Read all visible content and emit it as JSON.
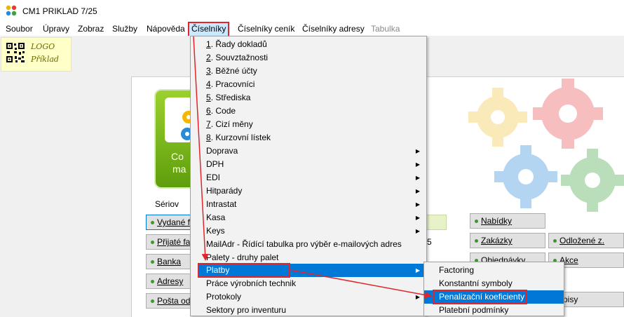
{
  "window": {
    "title": "CM1 PRIKLAD 7/25"
  },
  "menubar": {
    "items": [
      "Soubor",
      "Úpravy",
      "Zobraz",
      "Služby",
      "Nápověda",
      "Číselníky",
      "Číselníky ceník",
      "Číselníky adresy",
      "Tabulka"
    ]
  },
  "logo": {
    "line1": "LOGO",
    "line2": "Příklad"
  },
  "dashboard": {
    "tile_text1": "Co",
    "tile_text2": "ma",
    "serial_label": "Sériov",
    "number_text": "5",
    "left_buttons": [
      "Vydané f",
      "Přijaté fa",
      "Banka",
      "Adresy",
      "Pošta od"
    ],
    "right_buttons": [
      "Nabídky",
      "Zakázky",
      "Odložené z.",
      "Objednávky",
      "Akce",
      "pisy"
    ]
  },
  "dropdown": {
    "numbered": [
      {
        "num": "1",
        "rest": ". Řady dokladů"
      },
      {
        "num": "2",
        "rest": ". Souvztažnosti"
      },
      {
        "num": "3",
        "rest": ". Běžné účty"
      },
      {
        "num": "4",
        "rest": ". Pracovníci"
      },
      {
        "num": "5",
        "rest": ". Střediska"
      },
      {
        "num": "6",
        "rest": ". Code"
      },
      {
        "num": "7",
        "rest": ". Cizí měny"
      },
      {
        "num": "8",
        "rest": ". Kurzovní lístek"
      }
    ],
    "items": [
      {
        "label": "Doprava",
        "submenu": true
      },
      {
        "label": "DPH",
        "submenu": true
      },
      {
        "label": "EDI",
        "submenu": true
      },
      {
        "label": "Hitparády",
        "submenu": true
      },
      {
        "label": "Intrastat",
        "submenu": true
      },
      {
        "label": "Kasa",
        "submenu": true
      },
      {
        "label": "Keys",
        "submenu": true
      },
      {
        "label": "MailAdr - Řídící tabulka pro výběr e-mailových adres",
        "submenu": false
      },
      {
        "label": "Palety - druhy palet",
        "submenu": false
      },
      {
        "label": "Platby",
        "submenu": true,
        "selected": true
      },
      {
        "label": "Práce výrobních technik",
        "submenu": false
      },
      {
        "label": "Protokoly",
        "submenu": true
      },
      {
        "label": "Sektory pro inventuru",
        "submenu": false
      }
    ]
  },
  "submenu": {
    "items": [
      "Factoring",
      "Konstantní symboly",
      "Penalizační koeficienty",
      "Platební podmínky"
    ],
    "selected": "Penalizační koeficienty"
  },
  "colors": {
    "highlight": "#0078d7",
    "annotation_red": "#e0262d"
  }
}
